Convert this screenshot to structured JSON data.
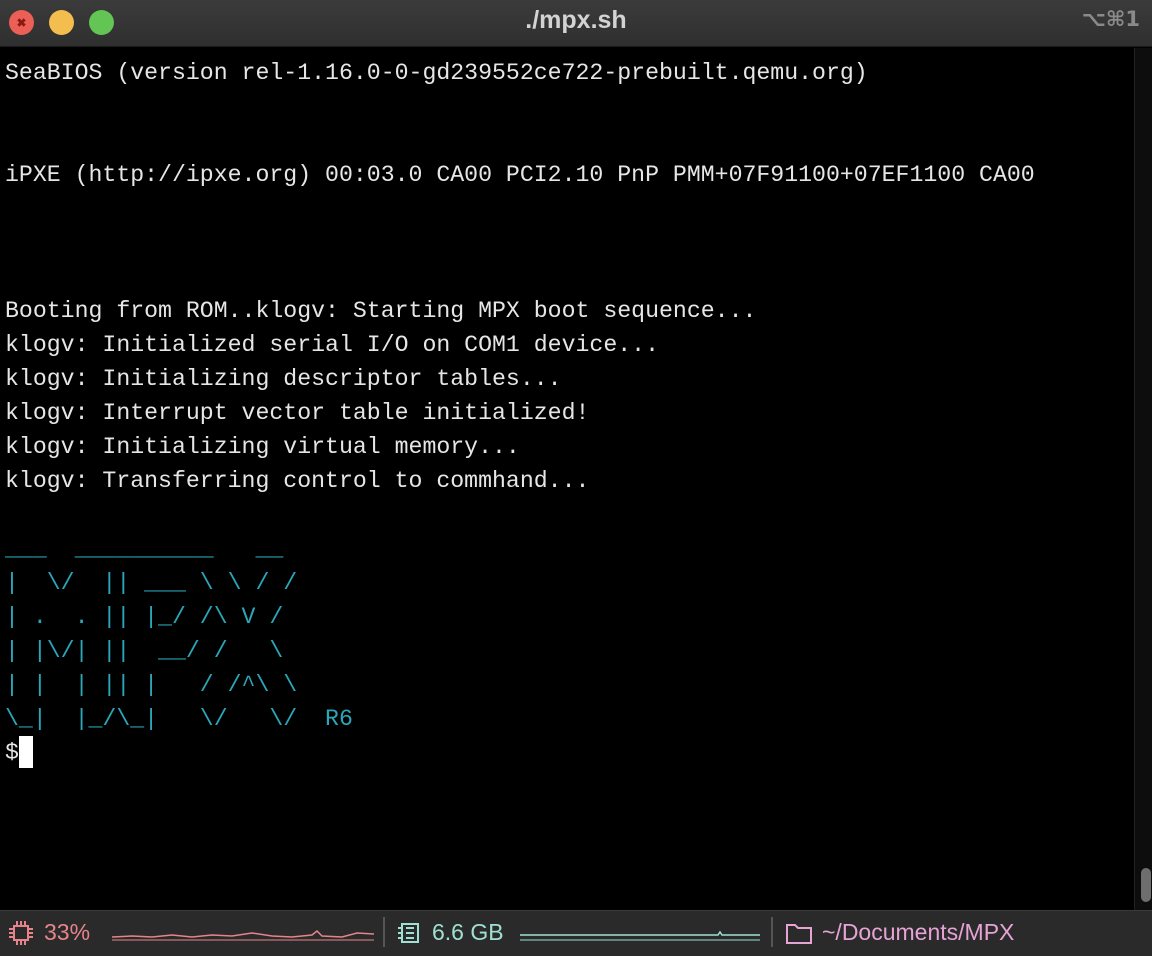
{
  "window": {
    "title": "./mpx.sh",
    "shortcut": "⌥⌘1"
  },
  "terminal": {
    "boot_lines": [
      "SeaBIOS (version rel-1.16.0-0-gd239552ce722-prebuilt.qemu.org)",
      "",
      "",
      "iPXE (http://ipxe.org) 00:03.0 CA00 PCI2.10 PnP PMM+07F91100+07EF1100 CA00",
      "",
      "",
      "",
      "Booting from ROM..klogv: Starting MPX boot sequence...",
      "klogv: Initialized serial I/O on COM1 device...",
      "klogv: Initializing descriptor tables...",
      "klogv: Interrupt vector table initialized!",
      "klogv: Initializing virtual memory...",
      "klogv: Transferring control to commhand...",
      ""
    ],
    "ascii_art": [
      "___  __________   __",
      "|  \\/  || ___ \\ \\ / /",
      "| .  . || |_/ /\\ V /",
      "| |\\/| ||  __/ /   \\",
      "| |  | || |   / /^\\ \\",
      "\\_|  |_/\\_|   \\/   \\/  R6"
    ],
    "prompt": "$",
    "colors": {
      "text": "#e6e6e6",
      "ascii": "#2aa6b8",
      "background": "#000000"
    }
  },
  "statusbar": {
    "cpu": {
      "icon": "cpu-chip-icon",
      "value": "33%",
      "color": "#e5858b"
    },
    "memory": {
      "icon": "memory-icon",
      "value": "6.6 GB",
      "color": "#9fe0d2"
    },
    "path": {
      "icon": "folder-icon",
      "value": "~/Documents/MPX",
      "color": "#e6a4d6"
    }
  }
}
